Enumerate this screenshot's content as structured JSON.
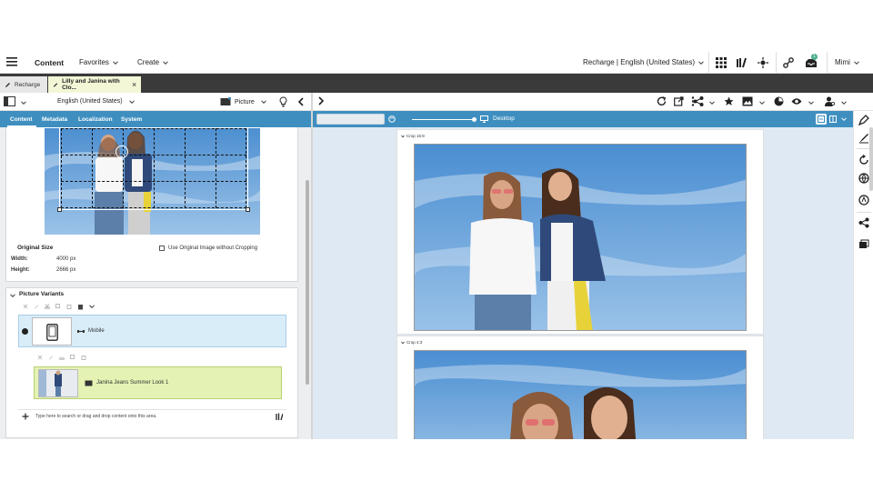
{
  "topnav": {
    "content": "Content",
    "favorites": "Favorites",
    "create": "Create",
    "site": "Recharge | English (United States)",
    "user": "Mimi",
    "notification_count": "1"
  },
  "tabs": [
    {
      "label": "Recharge"
    },
    {
      "label": "Lilly and Janina with Clo..."
    }
  ],
  "left_toolbar": {
    "locale": "English (United States)",
    "type": "Picture"
  },
  "left_tabs": [
    "Content",
    "Metadata",
    "Localization",
    "System"
  ],
  "image_info": {
    "original_size_label": "Original Size",
    "width_label": "Width:",
    "width_value": "4000 px",
    "height_label": "Height:",
    "height_value": "2666 px",
    "checkbox_label": "Use Original Image without Cropping"
  },
  "variants": {
    "title": "Picture Variants",
    "mobile": "Mobile",
    "item": "Janina Jeans Summer Look 1",
    "search_placeholder": "Type here to search or drag and drop content onto this area."
  },
  "preview": {
    "device": "Desktop",
    "crop1": "Crop 16:9",
    "crop2": "Crop 4:3"
  },
  "colors": {
    "accent": "#3e8fc0",
    "tabbar": "#3a3a3a",
    "active_tab": "#f3f7d6",
    "mobile_row": "#d9edf9",
    "item_row": "#e4f3b4"
  }
}
